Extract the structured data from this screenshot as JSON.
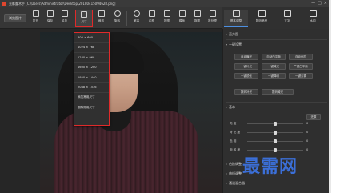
{
  "window": {
    "title": "光影魔术手 [C:\\Users\\Administrator\\Desktop\\20180415094628.png]",
    "controls": [
      "—",
      "□",
      "×"
    ]
  },
  "toolbar": {
    "open_label": "浏览图片",
    "tools": [
      {
        "label": "打开",
        "icon": "open-folder-icon"
      },
      {
        "label": "保存",
        "icon": "save-icon"
      },
      {
        "label": "另存",
        "icon": "save-as-icon"
      },
      {
        "label": "尺寸",
        "icon": "resize-icon"
      },
      {
        "label": "裁剪",
        "icon": "crop-icon"
      },
      {
        "label": "旋转",
        "icon": "rotate-icon"
      },
      {
        "label": "美容",
        "icon": "beauty-icon"
      },
      {
        "label": "边框",
        "icon": "frame-icon"
      },
      {
        "label": "拼图",
        "icon": "collage-icon"
      },
      {
        "label": "模板",
        "icon": "template-icon"
      },
      {
        "label": "抠图",
        "icon": "cutout-icon"
      },
      {
        "label": "批处理",
        "icon": "batch-icon"
      }
    ]
  },
  "right_tabs": [
    {
      "label": "基本调整",
      "icon": "adjust-icon"
    },
    {
      "label": "数码暗房",
      "icon": "camera-icon"
    },
    {
      "label": "文字",
      "icon": "text-icon"
    },
    {
      "label": "水印",
      "icon": "watermark-icon"
    }
  ],
  "size_dropdown": {
    "items": [
      "800 × 600",
      "1024 × 768",
      "1280 × 960",
      "1600 × 1200",
      "1920 × 1440",
      "2048 × 1536",
      "添加常用尺寸",
      "删除常用尺寸"
    ]
  },
  "panel": {
    "section_histogram": "直方图",
    "section_oneclick": "一键设置",
    "oneclick_buttons": [
      "自动曝光",
      "自动白平衡",
      "自动色阶",
      "一键补光",
      "一键减光",
      "严重白平衡",
      "一键锐化",
      "一键降噪",
      "一键去雾"
    ],
    "extra_buttons": [
      "数码补光",
      "数码减光"
    ],
    "section_basic": "基本",
    "reset_label": "还原",
    "sliders": [
      {
        "label": "亮 度",
        "value": "0"
      },
      {
        "label": "对 比 度",
        "value": "0"
      },
      {
        "label": "色 相",
        "value": "0"
      },
      {
        "label": "饱 和 度",
        "value": "0"
      }
    ],
    "collapsed_sections": [
      "色阶调整",
      "曲线调整",
      "通道混合器",
      "色彩平衡"
    ]
  },
  "watermark": {
    "text": "最需网",
    "color": "#3b6fd8"
  },
  "colors": {
    "highlight": "#e02a2a",
    "background": "#2b2b2b",
    "accent_tab": "#4d8fe0"
  }
}
